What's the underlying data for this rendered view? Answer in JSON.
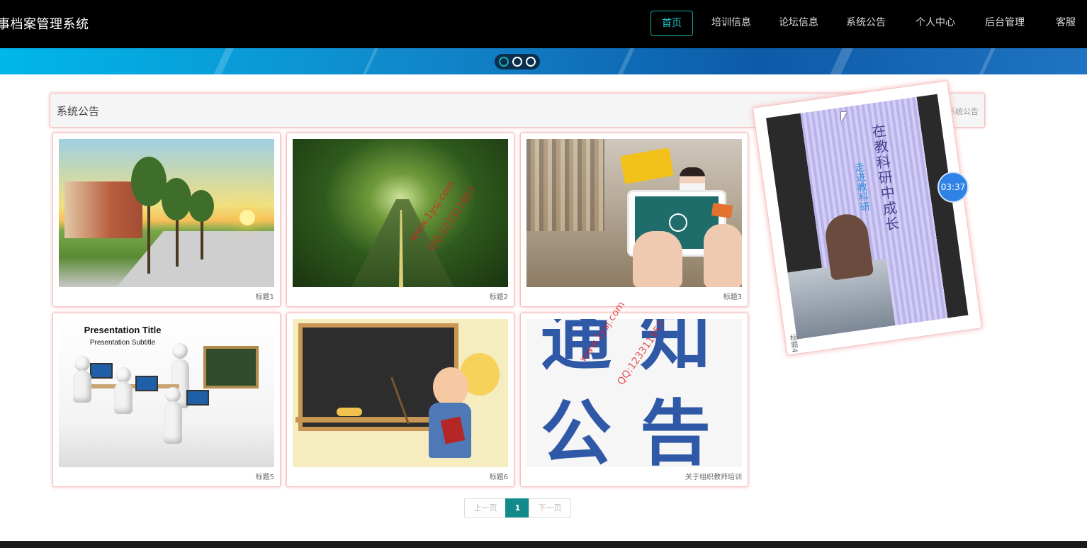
{
  "header": {
    "brand": "事档案管理系统",
    "nav": [
      {
        "label": "首页",
        "active": true
      },
      {
        "label": "培训信息",
        "active": false
      },
      {
        "label": "论坛信息",
        "active": false
      },
      {
        "label": "系统公告",
        "active": false
      },
      {
        "label": "个人中心",
        "active": false
      },
      {
        "label": "后台管理",
        "active": false
      },
      {
        "label": "客服",
        "active": false
      }
    ]
  },
  "banner": {
    "slide_count": 3,
    "active_slide": 1
  },
  "section": {
    "title": "系统公告",
    "right_label": "系统公告"
  },
  "cards": [
    {
      "caption": "标题1"
    },
    {
      "caption": "标题2"
    },
    {
      "caption": "标题3"
    },
    {
      "caption": "标题5"
    },
    {
      "caption": "标题6"
    },
    {
      "caption": "关于组织教师培训"
    }
  ],
  "card5_art": {
    "title": "Presentation Title",
    "subtitle": "Presentation Subtitle"
  },
  "card7_art": {
    "chars": [
      "通",
      "知",
      "公",
      "告"
    ]
  },
  "floating_card": {
    "caption": "标题4",
    "screen_text_main": "在教科研中成长",
    "screen_text_sub": "走进教科研",
    "timer": "03:37"
  },
  "watermarks": [
    "www.1ysj.com",
    "QQ:123311957",
    "www.1ysj.com",
    "QQ:123311957"
  ],
  "pagination": {
    "prev": "上一页",
    "current": "1",
    "next": "下一页"
  },
  "colors": {
    "accent": "#138a8a",
    "card_glow": "#f7b3b3",
    "timer": "#2f83e6"
  }
}
